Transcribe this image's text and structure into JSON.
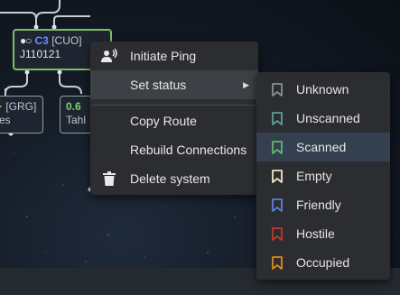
{
  "map": {
    "nodes": [
      {
        "id": "c3",
        "sec": "C3",
        "cls": "[CUO]",
        "name": "J110121"
      },
      {
        "id": "grg",
        "cls": "[GRG]",
        "name": "es"
      },
      {
        "id": "tahl",
        "sec": "0.6",
        "name": "Tahl"
      }
    ]
  },
  "context_menu": {
    "items": [
      {
        "label": "Initiate Ping",
        "icon": "ping-icon"
      },
      {
        "label": "Set status",
        "icon": "",
        "submenu": true
      },
      {
        "label": "Copy Route",
        "icon": ""
      },
      {
        "label": "Rebuild Connections",
        "icon": ""
      },
      {
        "label": "Delete system",
        "icon": "trash-icon"
      }
    ]
  },
  "status_menu": {
    "items": [
      {
        "label": "Unknown",
        "color": "#8a8f96"
      },
      {
        "label": "Unscanned",
        "color": "#5f9e96"
      },
      {
        "label": "Scanned",
        "color": "#5fb86a"
      },
      {
        "label": "Empty",
        "color": "#f0e6c8"
      },
      {
        "label": "Friendly",
        "color": "#5b7fd6"
      },
      {
        "label": "Hostile",
        "color": "#c0392b"
      },
      {
        "label": "Occupied",
        "color": "#e08a1e"
      }
    ],
    "selected": "Scanned"
  }
}
